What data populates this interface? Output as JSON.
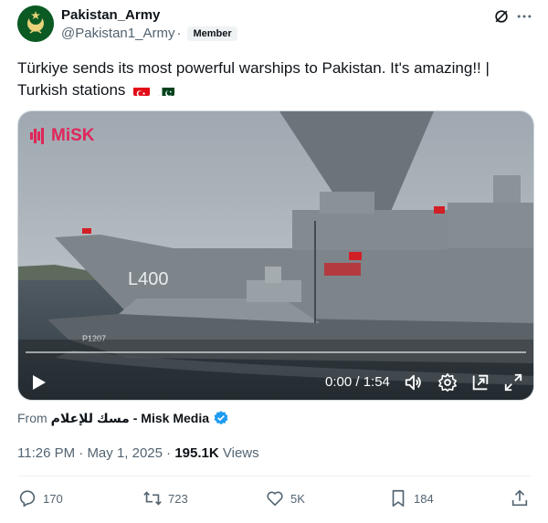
{
  "author": {
    "display_name": "Pakistan_Army",
    "handle": "@Pakistan1_Army",
    "separator": "·",
    "badge": "Member",
    "avatar_icon": "crescent-star-emblem-icon"
  },
  "tweet": {
    "text": "Türkiye sends its most powerful warships to Pakistan. It's amazing!! | Turkish stations",
    "flags": [
      "turkey-flag-icon",
      "pakistan-flag-icon"
    ]
  },
  "media": {
    "watermark": "MiSK",
    "hull_number_carrier": "L400",
    "hull_number_patrol": "P1207",
    "time_display": "0:00 / 1:54",
    "progress_fraction": 0.0
  },
  "source": {
    "prefix": "From",
    "name": "مسك للإعلام - Misk Media"
  },
  "meta": {
    "time": "11:26 PM",
    "date": "May 1, 2025",
    "views_count": "195.1K",
    "views_label": "Views"
  },
  "actions": {
    "replies": "170",
    "reposts": "723",
    "likes": "5K",
    "bookmarks": "184"
  },
  "colors": {
    "avatar_green": "#0b5a23",
    "verified_blue": "#1d9bf0",
    "secondary_text": "#536471"
  }
}
